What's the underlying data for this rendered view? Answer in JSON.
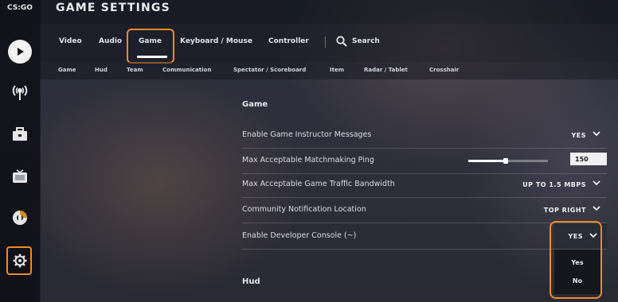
{
  "app": {
    "logo": "CS:GO"
  },
  "header": {
    "title": "GAME SETTINGS"
  },
  "tabs": [
    {
      "label": "Video",
      "active": false
    },
    {
      "label": "Audio",
      "active": false
    },
    {
      "label": "Game",
      "active": true
    },
    {
      "label": "Keyboard / Mouse",
      "active": false
    },
    {
      "label": "Controller",
      "active": false
    }
  ],
  "search": {
    "label": "Search",
    "icon": "search-icon"
  },
  "subtabs": [
    "Game",
    "Hud",
    "Team",
    "Communication",
    "Spectator / Scoreboard",
    "Item",
    "Radar / Tablet",
    "Crosshair"
  ],
  "sidebar": {
    "items": [
      {
        "icon": "play-icon"
      },
      {
        "icon": "broadcast-icon"
      },
      {
        "icon": "briefcase-icon"
      },
      {
        "icon": "tv-icon"
      },
      {
        "icon": "stats-icon"
      },
      {
        "icon": "gear-icon"
      }
    ]
  },
  "sections": {
    "game": "Game",
    "hud": "Hud"
  },
  "settings": [
    {
      "label": "Enable Game Instructor Messages",
      "value": "YES"
    },
    {
      "label": "Max Acceptable Matchmaking Ping",
      "value": "150",
      "slider_fraction": 0.47
    },
    {
      "label": "Max Acceptable Game Traffic Bandwidth",
      "value": "UP TO 1.5 MBPS"
    },
    {
      "label": "Community Notification Location",
      "value": "TOP RIGHT"
    },
    {
      "label": "Enable Developer Console (~)",
      "value": "YES"
    }
  ],
  "dropdown": {
    "options": [
      "Yes",
      "No"
    ]
  },
  "colors": {
    "highlight": "#f28a25",
    "text": "#e6e9ee"
  }
}
